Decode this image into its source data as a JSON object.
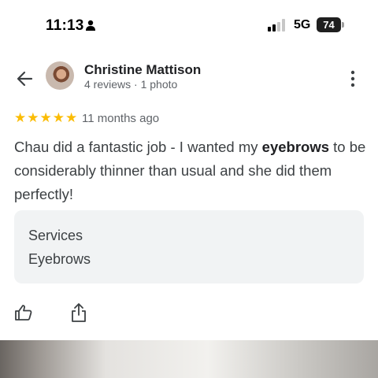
{
  "status_bar": {
    "time": "11:13",
    "network": "5G",
    "battery": "74"
  },
  "header": {
    "reviewer_name": "Christine Mattison",
    "reviewer_meta": "4 reviews · 1 photo",
    "icons": [
      "back-arrow-icon",
      "more-vert-icon"
    ]
  },
  "review": {
    "rating": 5,
    "star_glyph": "★",
    "date": "11 months ago",
    "text_before": "Chau did a fantastic job - I wanted my ",
    "text_bold": "eyebrows",
    "text_after": " to be considerably thinner than usual and she did them perfectly!"
  },
  "services": {
    "title": "Services",
    "value": "Eyebrows"
  },
  "actions": {
    "icons": [
      "thumb-up-icon",
      "share-icon"
    ]
  },
  "colors": {
    "star": "#fbbc04",
    "card_bg": "#f1f3f4",
    "secondary_text": "#5f6368"
  }
}
